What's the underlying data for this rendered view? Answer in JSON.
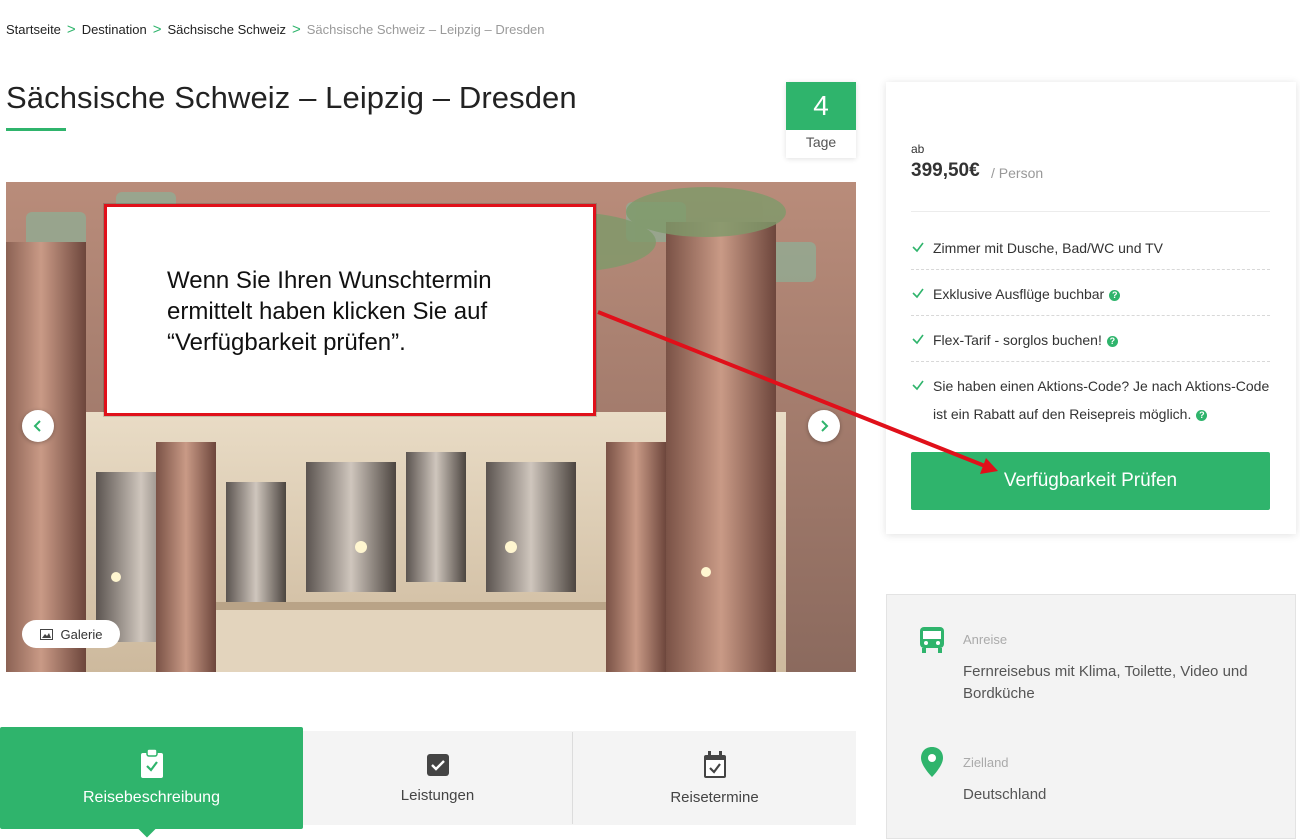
{
  "breadcrumb": {
    "items": [
      "Startseite",
      "Destination",
      "Sächsische Schweiz",
      "Sächsische Schweiz – Leipzig – Dresden"
    ],
    "separator": ">"
  },
  "tour": {
    "title": "Sächsische Schweiz – Leipzig – Dresden",
    "days_value": "4",
    "days_label": "Tage"
  },
  "hero": {
    "gallery_label": "Galerie",
    "prev_icon": "chevron-left-icon",
    "next_icon": "chevron-right-icon"
  },
  "annotation": {
    "text": "Wenn Sie Ihren Wunschtermin ermittelt haben klicken Sie auf “Verfügbarkeit prüfen”.",
    "border_color": "#e0101a"
  },
  "tabs": [
    {
      "label": "Reisebeschreibung",
      "icon": "clipboard-check-icon",
      "active": true
    },
    {
      "label": "Leistungen",
      "icon": "checkbox-icon",
      "active": false
    },
    {
      "label": "Reisetermine",
      "icon": "calendar-check-icon",
      "active": false
    }
  ],
  "pricing": {
    "from_label": "ab",
    "price": "399,50€",
    "per_person": "/ Person",
    "features": [
      {
        "text": "Zimmer mit Dusche, Bad/WC und TV",
        "help": false
      },
      {
        "text": "Exklusive Ausflüge buchbar",
        "help": true
      },
      {
        "text": "Flex-Tarif - sorglos buchen!",
        "help": true
      },
      {
        "text": "Sie haben einen Aktions-Code? Je nach Aktions-Code ist ein Rabatt auf den Reisepreis möglich.",
        "help": true
      }
    ],
    "cta_label": "Verfügbarkeit Prüfen"
  },
  "info": {
    "arrival_label": "Anreise",
    "arrival_value": "Fernreisebus mit Klima, Toilette, Video und Bordküche",
    "arrival_icon": "bus-icon",
    "destination_label": "Zielland",
    "destination_value": "Deutschland",
    "destination_icon": "map-pin-icon"
  },
  "colors": {
    "accent": "#2fb46c",
    "annotation": "#e0101a"
  }
}
